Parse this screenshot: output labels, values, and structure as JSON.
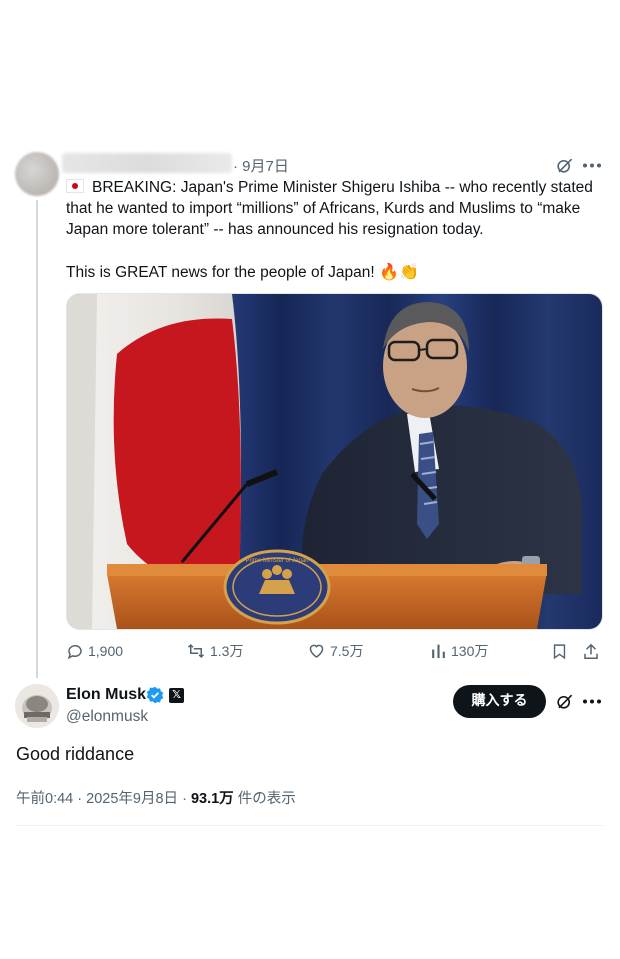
{
  "parent_tweet": {
    "date": "9月7日",
    "text_line1": "BREAKING: Japan's Prime Minister Shigeru Ishiba -- who recently stated that he wanted to import “millions” of Africans, Kurds and Muslims to “make Japan more tolerant” -- has announced his resignation today.",
    "text_line2": "This is GREAT news for the people of Japan!",
    "emojis": "🔥👏",
    "image_description_icon": "press-conference-photo",
    "podium_emblem_text": "Prime Minister of Japan",
    "actions": {
      "replies": "1,900",
      "reposts": "1.3万",
      "likes": "7.5万",
      "views": "130万"
    }
  },
  "main_tweet": {
    "author_name": "Elon Musk",
    "handle": "@elonmusk",
    "buy_label": "購入する",
    "text": "Good riddance",
    "time": "午前0:44",
    "date": "2025年9月8日",
    "views_count": "93.1万",
    "views_suffix": "件の表示",
    "separator": "·"
  },
  "colors": {
    "text": "#0f1419",
    "muted": "#536471",
    "verified": "#1d9bf0",
    "button": "#0f1419"
  }
}
